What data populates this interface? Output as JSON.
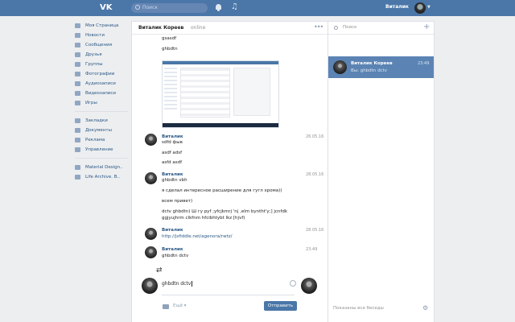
{
  "topbar": {
    "logo": "VK",
    "search_placeholder": "Поиск",
    "user_name": "Виталик"
  },
  "nav": {
    "main_items": [
      {
        "label": "Моя Страница",
        "icon": "home-icon"
      },
      {
        "label": "Новости",
        "icon": "news-icon"
      },
      {
        "label": "Сообщения",
        "icon": "message-icon"
      },
      {
        "label": "Друзья",
        "icon": "friends-icon"
      },
      {
        "label": "Группы",
        "icon": "groups-icon"
      },
      {
        "label": "Фотографии",
        "icon": "photo-icon"
      },
      {
        "label": "Аудиозаписи",
        "icon": "audio-icon"
      },
      {
        "label": "Видеозаписи",
        "icon": "video-icon"
      },
      {
        "label": "Игры",
        "icon": "games-icon"
      }
    ],
    "extra_items": [
      {
        "label": "Закладки",
        "icon": "star-icon"
      },
      {
        "label": "Документы",
        "icon": "document-icon"
      },
      {
        "label": "Реклама",
        "icon": "ads-icon"
      },
      {
        "label": "Управление",
        "icon": "manage-icon"
      }
    ],
    "app_items": [
      {
        "label": "Material Design..",
        "icon": "app-icon"
      },
      {
        "label": "Life Archive. В..",
        "icon": "app-icon"
      }
    ]
  },
  "chat": {
    "header": {
      "name": "Виталик Кореев",
      "status": "online"
    },
    "messages": {
      "m0_line1": "gsasdf",
      "m0_line2": "ghbdtn",
      "m1_author": "Виталик",
      "m1_time": "26.05.16",
      "m1_line1": "sdfd фыв",
      "m1_line2": "asdf adsf",
      "m1_line3": "asfd asdf",
      "m2_author": "Виталик",
      "m2_time": "28.05.16",
      "m2_line1": "ghbdtn vbh",
      "m2_line2": "я сделал интересное расширение для гугл хрома))",
      "m2_line3": "всем привет)",
      "m2_line4": "dctv ghbdtn) Ш гу рyf ;yfcjkmrj 'nj ,elm byntht'y;] jcnfdk",
      "m2_line5": "ggjyujhrm clkfnm hfcibhtybt lkz [hjvf)",
      "m3_author": "Виталик",
      "m3_time": "28.05.16",
      "m3_link": "http://jsfiddle.net/agenora/rwtz/",
      "m4_author": "Виталик",
      "m4_time": "23:49",
      "m4_line1": "ghbdtn dctv"
    },
    "compose": {
      "draft": "ghbdtn dctv",
      "more_label": "Ещё",
      "send_label": "Отправить"
    }
  },
  "dialogs": {
    "search_placeholder": "Поиск",
    "items": [
      {
        "name": "Виталик Кореев",
        "time": "23:49",
        "preview": "Вы: ghbdtn dctv"
      }
    ],
    "footer": "Показаны все беседы"
  },
  "colors": {
    "header": "#4a76a8",
    "link": "#2a5885",
    "selected_dialog": "#5b84b4"
  }
}
